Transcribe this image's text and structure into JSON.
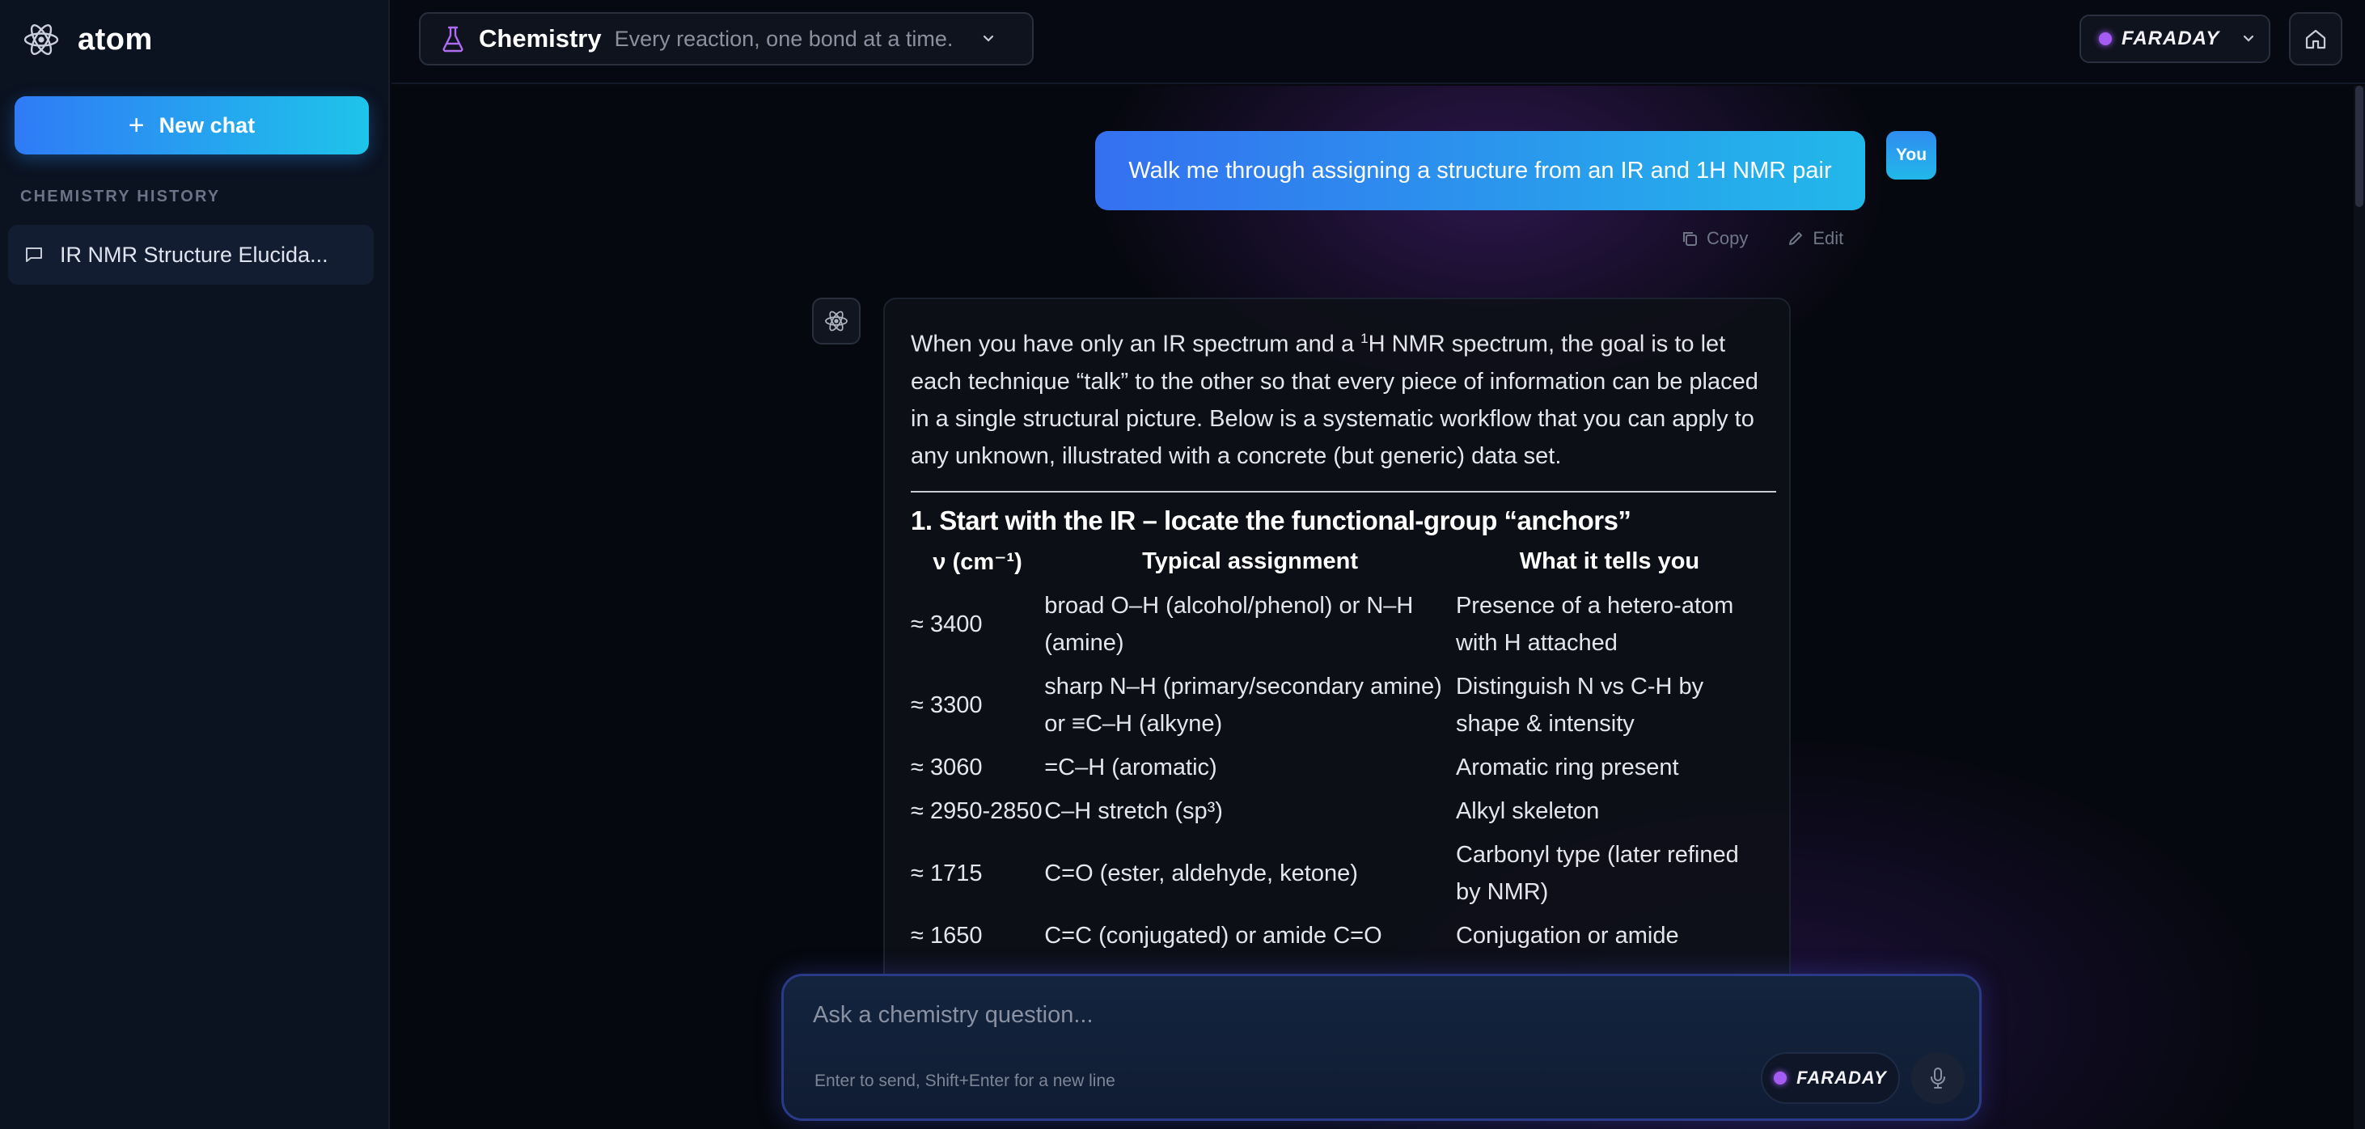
{
  "app": {
    "name": "atom"
  },
  "sidebar": {
    "new_chat_label": "New chat",
    "history_title": "CHEMISTRY HISTORY",
    "history_items": [
      {
        "label": "IR NMR Structure Elucida..."
      }
    ]
  },
  "header": {
    "subject": "Chemistry",
    "tagline": "Every reaction, one bond at a time.",
    "model": "FARADAY"
  },
  "chat": {
    "user_message": "Walk me through assigning a structure from an IR and 1H NMR pair",
    "user_avatar": "You",
    "actions": {
      "copy": "Copy",
      "edit": "Edit"
    },
    "assistant": {
      "intro_a": "When you have only an IR spectrum and a ",
      "intro_sup": "1",
      "intro_b": "H NMR spectrum, the goal is to let each technique “talk” to the other so that every piece of information can be placed in a single structural picture. Below is a systematic workflow that you can apply to any unknown, illustrated with a concrete (but generic) data set.",
      "section_title": "1. Start with the IR – locate the functional-group “anchors”",
      "table": {
        "headers": [
          "ν (cm⁻¹)",
          "Typical assignment",
          "What it tells you"
        ],
        "rows": [
          [
            "≈ 3400",
            "broad O–H (alcohol/phenol) or N–H (amine)",
            "Presence of a hetero-atom with H attached"
          ],
          [
            "≈ 3300",
            "sharp N–H (primary/secondary amine) or ≡C–H (alkyne)",
            "Distinguish N vs C-H by shape & intensity"
          ],
          [
            "≈ 3060",
            "=C–H (aromatic)",
            "Aromatic ring present"
          ],
          [
            "≈ 2950-2850",
            "C–H stretch (sp³)",
            "Alkyl skeleton"
          ],
          [
            "≈ 1715",
            "C=O (ester, aldehyde, ketone)",
            "Carbonyl type (later refined by NMR)"
          ],
          [
            "≈ 1650",
            "C=C (conjugated) or amide C=O",
            "Conjugation or amide"
          ]
        ]
      }
    }
  },
  "composer": {
    "placeholder": "Ask a chemistry question...",
    "hint": "Enter to send, Shift+Enter for a new line",
    "model": "FARADAY"
  },
  "colors": {
    "accent_gradient_start": "#2f7bf6",
    "accent_gradient_end": "#1ec4ea",
    "model_dot": "#a55cf5",
    "flask_icon": "#b06bf5"
  }
}
